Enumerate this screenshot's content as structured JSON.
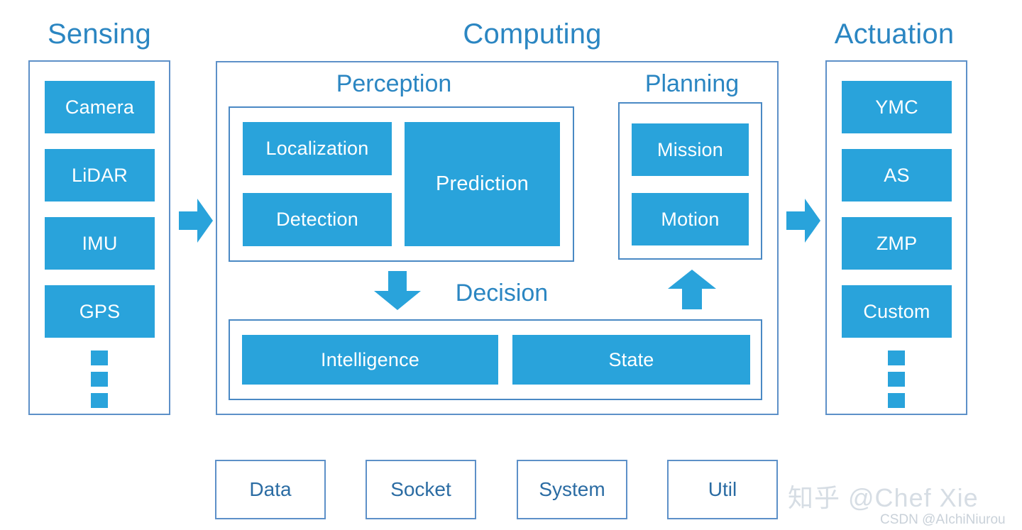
{
  "colors": {
    "block_fill": "#29a3db",
    "frame_border": "#5d90c8",
    "title_text": "#2b86c2",
    "block_text": "#ffffff",
    "util_text": "#2b6ca3",
    "background": "#ffffff",
    "watermark": "#d6dde4"
  },
  "sensing": {
    "title": "Sensing",
    "items": [
      {
        "label": "Camera"
      },
      {
        "label": "LiDAR"
      },
      {
        "label": "IMU"
      },
      {
        "label": "GPS"
      }
    ],
    "ellipsis": "more-sensors-ellipsis"
  },
  "computing": {
    "title": "Computing",
    "perception": {
      "title": "Perception",
      "items": [
        {
          "label": "Localization"
        },
        {
          "label": "Detection"
        },
        {
          "label": "Prediction"
        }
      ]
    },
    "planning": {
      "title": "Planning",
      "items": [
        {
          "label": "Mission"
        },
        {
          "label": "Motion"
        }
      ]
    },
    "decision": {
      "title": "Decision",
      "items": [
        {
          "label": "Intelligence"
        },
        {
          "label": "State"
        }
      ]
    }
  },
  "actuation": {
    "title": "Actuation",
    "items": [
      {
        "label": "YMC"
      },
      {
        "label": "AS"
      },
      {
        "label": "ZMP"
      },
      {
        "label": "Custom"
      }
    ],
    "ellipsis": "more-actuators-ellipsis"
  },
  "support_modules": [
    {
      "label": "Data"
    },
    {
      "label": "Socket"
    },
    {
      "label": "System"
    },
    {
      "label": "Util"
    }
  ],
  "arrows": {
    "sensing_to_computing": "arrow-right-icon",
    "computing_to_actuation": "arrow-right-icon",
    "perception_to_decision": "arrow-down-icon",
    "decision_to_planning": "arrow-up-icon"
  },
  "watermarks": {
    "zhihu": "知乎 @Chef Xie",
    "csdn": "CSDN @AIchiNiurou"
  }
}
